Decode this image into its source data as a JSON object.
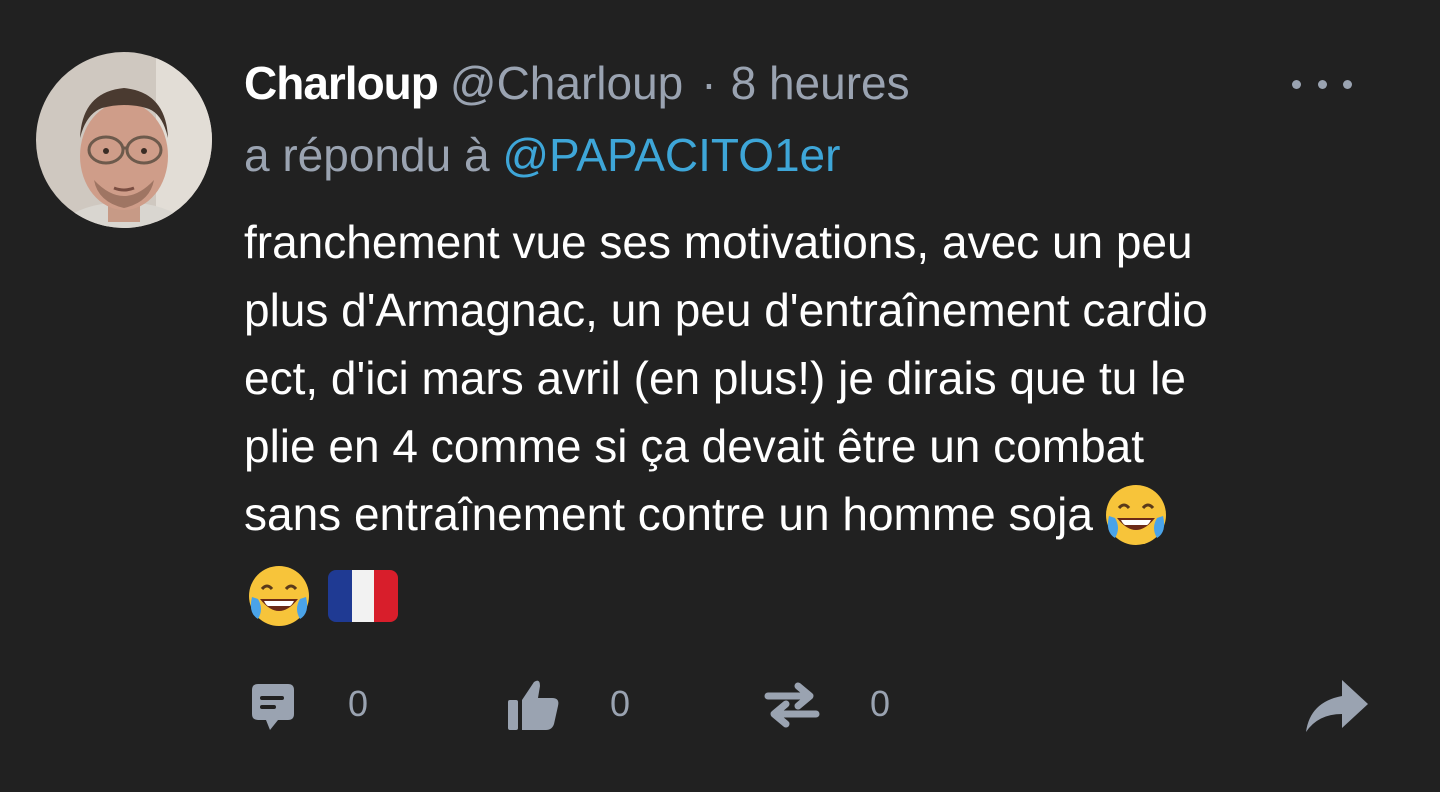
{
  "comment": {
    "author_name": "Charloup",
    "author_handle": "@Charloup",
    "separator": "·",
    "timestamp": "8 heures",
    "reply_prefix": "a répondu à",
    "reply_to": "@PAPACITO1er",
    "body_lines": [
      "franchement vue ses motivations, avec un peu",
      "plus d'Armagnac, un peu d'entraînement cardio",
      "ect, d'ici mars avril (en plus!) je dirais que tu le",
      "plie en 4 comme si ça devait être un combat",
      "sans entraînement contre un homme soja"
    ],
    "emojis": [
      "face-with-tears-of-joy",
      "face-with-tears-of-joy",
      "flag-france"
    ]
  },
  "actions": {
    "reply_count": "0",
    "like_count": "0",
    "retweet_count": "0"
  },
  "icons": [
    "more-icon",
    "reply-icon",
    "like-icon",
    "retweet-icon",
    "share-icon"
  ],
  "colors": {
    "background": "#212121",
    "text": "#ffffff",
    "muted": "#9aa3b1",
    "mention": "#3ea6d8"
  }
}
